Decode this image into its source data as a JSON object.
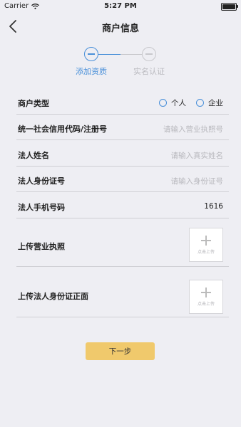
{
  "status_bar": {
    "carrier": "Carrier",
    "time": "5:27 PM",
    "battery_level": 1.0
  },
  "nav": {
    "title": "商户信息"
  },
  "steps": [
    {
      "label": "添加资质",
      "active": true
    },
    {
      "label": "实名认证",
      "active": false
    }
  ],
  "form": {
    "merchant_type": {
      "label": "商户类型",
      "options": [
        "个人",
        "企业"
      ]
    },
    "credit_code": {
      "label": "统一社会信用代码/注册号",
      "placeholder": "请输入营业执照号"
    },
    "legal_name": {
      "label": "法人姓名",
      "placeholder": "请输入真实姓名"
    },
    "legal_id": {
      "label": "法人身份证号",
      "placeholder": "请输入身份证号"
    },
    "legal_phone": {
      "label": "法人手机号码",
      "value": "1616"
    },
    "upload_license": {
      "label": "上传营业执照",
      "button_text": "点击上传"
    },
    "upload_id_front": {
      "label": "上传法人身份证正面",
      "button_text": "点击上传"
    }
  },
  "next_button": {
    "label": "下一步"
  },
  "colors": {
    "accent": "#4a90d9",
    "button": "#f0c96c",
    "background": "#eeeef3"
  }
}
